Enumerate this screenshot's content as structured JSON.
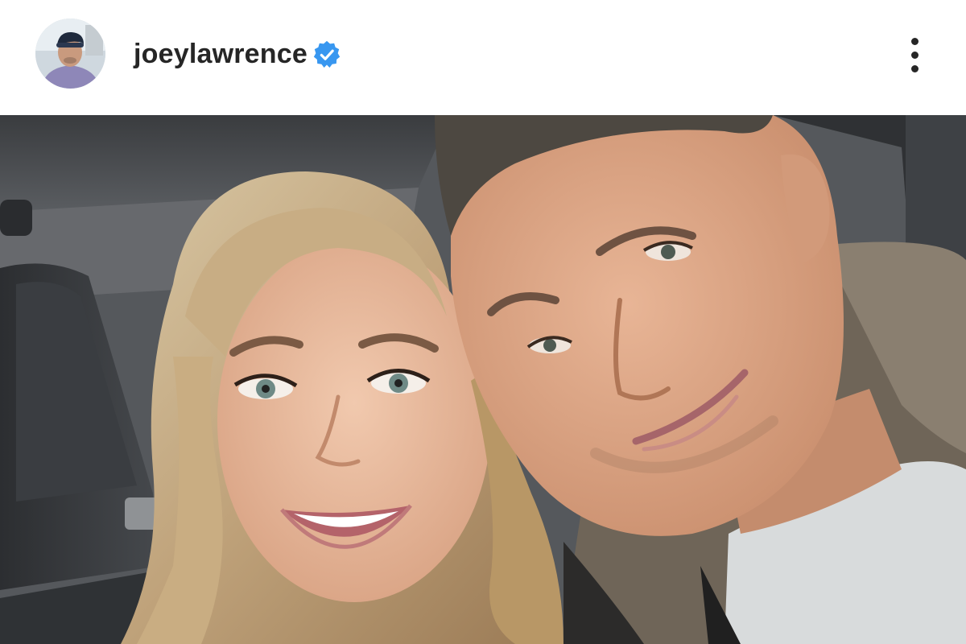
{
  "post": {
    "username": "joeylawrence",
    "verified": true,
    "menu_icon": "more-vertical-icon"
  },
  "colors": {
    "verified_badge": "#3897f0",
    "username_text": "#262626",
    "header_background": "#ffffff"
  }
}
